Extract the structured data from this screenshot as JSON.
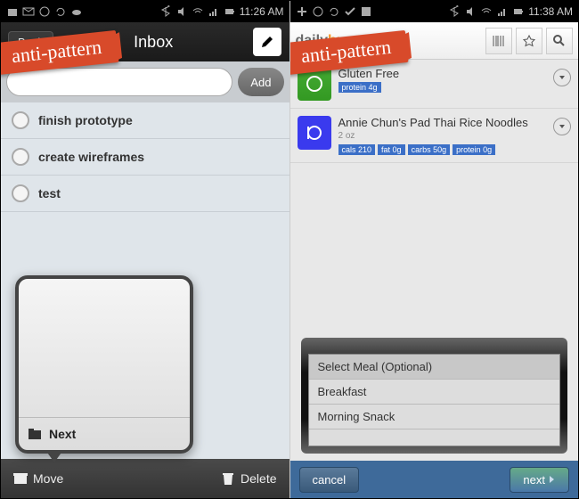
{
  "left": {
    "status": {
      "time": "11:26 AM"
    },
    "header": {
      "back": "Back",
      "title": "Inbox"
    },
    "addbar": {
      "placeholder": "",
      "add_label": "Add"
    },
    "todos": [
      "finish prototype",
      "create wireframes",
      "test"
    ],
    "popover": {
      "next": "Next"
    },
    "bottom": {
      "move": "Move",
      "delete": "Delete"
    }
  },
  "right": {
    "status": {
      "time": "11:38 AM"
    },
    "brand": {
      "p1": "daily",
      "p2": "burn"
    },
    "foods": [
      {
        "name": "Gluten Free",
        "size": "",
        "tags": [
          "protein 4g"
        ]
      },
      {
        "name": "Annie Chun's Pad Thai Rice Noodles",
        "size": "2 oz",
        "tags": [
          "cals 210",
          "fat 0g",
          "carbs 50g",
          "protein 0g"
        ]
      }
    ],
    "picker": {
      "options": [
        "Select Meal (Optional)",
        "Breakfast",
        "Morning Snack"
      ],
      "selected": 0
    },
    "bottom": {
      "cancel": "cancel",
      "next": "next"
    }
  },
  "banner": "anti-pattern"
}
